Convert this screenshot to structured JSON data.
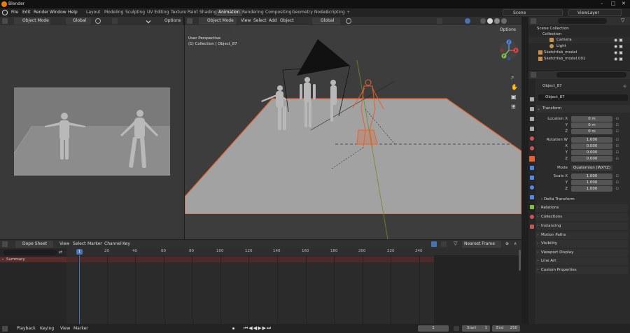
{
  "window": {
    "title": "Blender"
  },
  "menu": {
    "items": [
      "File",
      "Edit",
      "Render",
      "Window",
      "Help"
    ]
  },
  "workspaces": [
    {
      "label": "Layout",
      "active": false
    },
    {
      "label": "Modeling",
      "active": false
    },
    {
      "label": "Sculpting",
      "active": false
    },
    {
      "label": "UV Editing",
      "active": false
    },
    {
      "label": "Texture Paint",
      "active": false
    },
    {
      "label": "Shading",
      "active": false
    },
    {
      "label": "Animation",
      "active": true
    },
    {
      "label": "Rendering",
      "active": false
    },
    {
      "label": "Compositing",
      "active": false
    },
    {
      "label": "Geometry Nodes",
      "active": false
    },
    {
      "label": "Scripting",
      "active": false
    }
  ],
  "topbar": {
    "add_tab": "+",
    "scene": "Scene",
    "view_layer": "ViewLayer"
  },
  "left_viewport": {
    "mode": "Object Mode",
    "transform": "Global",
    "options": "Options"
  },
  "main_viewport": {
    "mode": "Object Mode",
    "menus": [
      "View",
      "Select",
      "Add",
      "Object"
    ],
    "transform": "Global",
    "options": "Options",
    "overlay_title": "User Perspective",
    "overlay_collection": "(1) Collection | Object_87",
    "gizmo": {
      "x": "X",
      "y": "Y",
      "z": "Z"
    }
  },
  "outliner": {
    "root": "Scene Collection",
    "collection": "Collection",
    "items": [
      "Camera",
      "Light",
      "Sketchfab_model",
      "Sketchfab_model.001"
    ]
  },
  "properties": {
    "object_name": "Object_87",
    "data_name": "Object_87",
    "transform_title": "Transform",
    "location": {
      "label": "Location X",
      "x": "0 m",
      "y": "0 m",
      "z": "0 m"
    },
    "rotation": {
      "label": "Rotation W",
      "w": "1.000",
      "x": "0.000",
      "y": "0.000",
      "z": "0.000"
    },
    "mode": {
      "label": "Mode",
      "value": "Quaternion (WXYZ)"
    },
    "scale": {
      "label": "Scale X",
      "x": "1.000",
      "y": "1.000",
      "z": "1.000"
    },
    "axis_labels": {
      "y": "Y",
      "z": "Z",
      "x": "X"
    },
    "delta": "Delta Transform",
    "panels": [
      "Relations",
      "Collections",
      "Instancing",
      "Motion Paths",
      "Visibility",
      "Viewport Display",
      "Line Art",
      "Custom Properties"
    ]
  },
  "dope_sheet": {
    "editor": "Dope Sheet",
    "menus": [
      "View",
      "Select",
      "Marker",
      "Channel",
      "Key"
    ],
    "snap": "Nearest Frame",
    "summary": "Summary",
    "current_frame": "1",
    "ticks": [
      "20",
      "40",
      "60",
      "80",
      "100",
      "120",
      "140",
      "160",
      "180",
      "200",
      "220",
      "240"
    ]
  },
  "footer": {
    "menus": [
      "Playback",
      "Keying",
      "View",
      "Marker"
    ],
    "frame": "1",
    "start_label": "Start",
    "start": "1",
    "end_label": "End",
    "end": "250"
  },
  "colors": {
    "accent": "#4772b3",
    "select": "#e8612c",
    "active_tab": "#3d3d3d"
  }
}
